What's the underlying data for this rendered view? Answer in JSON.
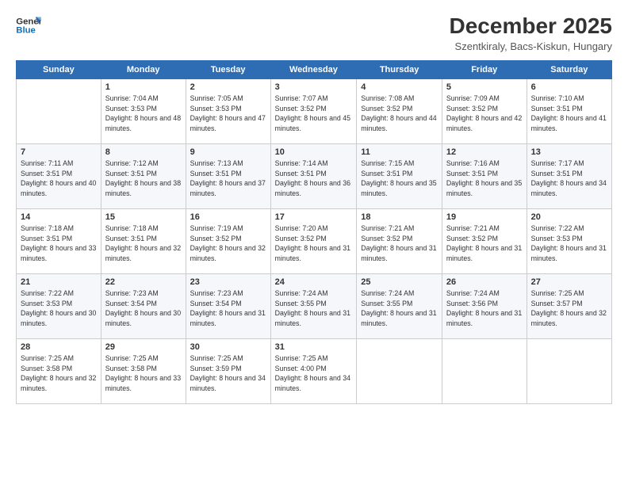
{
  "logo": {
    "line1": "General",
    "line2": "Blue"
  },
  "title": "December 2025",
  "subtitle": "Szentkiraly, Bacs-Kiskun, Hungary",
  "days_of_week": [
    "Sunday",
    "Monday",
    "Tuesday",
    "Wednesday",
    "Thursday",
    "Friday",
    "Saturday"
  ],
  "weeks": [
    [
      {
        "day": "",
        "info": ""
      },
      {
        "day": "1",
        "info": "Sunrise: 7:04 AM\nSunset: 3:53 PM\nDaylight: 8 hours\nand 48 minutes."
      },
      {
        "day": "2",
        "info": "Sunrise: 7:05 AM\nSunset: 3:53 PM\nDaylight: 8 hours\nand 47 minutes."
      },
      {
        "day": "3",
        "info": "Sunrise: 7:07 AM\nSunset: 3:52 PM\nDaylight: 8 hours\nand 45 minutes."
      },
      {
        "day": "4",
        "info": "Sunrise: 7:08 AM\nSunset: 3:52 PM\nDaylight: 8 hours\nand 44 minutes."
      },
      {
        "day": "5",
        "info": "Sunrise: 7:09 AM\nSunset: 3:52 PM\nDaylight: 8 hours\nand 42 minutes."
      },
      {
        "day": "6",
        "info": "Sunrise: 7:10 AM\nSunset: 3:51 PM\nDaylight: 8 hours\nand 41 minutes."
      }
    ],
    [
      {
        "day": "7",
        "info": "Sunrise: 7:11 AM\nSunset: 3:51 PM\nDaylight: 8 hours\nand 40 minutes."
      },
      {
        "day": "8",
        "info": "Sunrise: 7:12 AM\nSunset: 3:51 PM\nDaylight: 8 hours\nand 38 minutes."
      },
      {
        "day": "9",
        "info": "Sunrise: 7:13 AM\nSunset: 3:51 PM\nDaylight: 8 hours\nand 37 minutes."
      },
      {
        "day": "10",
        "info": "Sunrise: 7:14 AM\nSunset: 3:51 PM\nDaylight: 8 hours\nand 36 minutes."
      },
      {
        "day": "11",
        "info": "Sunrise: 7:15 AM\nSunset: 3:51 PM\nDaylight: 8 hours\nand 35 minutes."
      },
      {
        "day": "12",
        "info": "Sunrise: 7:16 AM\nSunset: 3:51 PM\nDaylight: 8 hours\nand 35 minutes."
      },
      {
        "day": "13",
        "info": "Sunrise: 7:17 AM\nSunset: 3:51 PM\nDaylight: 8 hours\nand 34 minutes."
      }
    ],
    [
      {
        "day": "14",
        "info": "Sunrise: 7:18 AM\nSunset: 3:51 PM\nDaylight: 8 hours\nand 33 minutes."
      },
      {
        "day": "15",
        "info": "Sunrise: 7:18 AM\nSunset: 3:51 PM\nDaylight: 8 hours\nand 32 minutes."
      },
      {
        "day": "16",
        "info": "Sunrise: 7:19 AM\nSunset: 3:52 PM\nDaylight: 8 hours\nand 32 minutes."
      },
      {
        "day": "17",
        "info": "Sunrise: 7:20 AM\nSunset: 3:52 PM\nDaylight: 8 hours\nand 31 minutes."
      },
      {
        "day": "18",
        "info": "Sunrise: 7:21 AM\nSunset: 3:52 PM\nDaylight: 8 hours\nand 31 minutes."
      },
      {
        "day": "19",
        "info": "Sunrise: 7:21 AM\nSunset: 3:52 PM\nDaylight: 8 hours\nand 31 minutes."
      },
      {
        "day": "20",
        "info": "Sunrise: 7:22 AM\nSunset: 3:53 PM\nDaylight: 8 hours\nand 31 minutes."
      }
    ],
    [
      {
        "day": "21",
        "info": "Sunrise: 7:22 AM\nSunset: 3:53 PM\nDaylight: 8 hours\nand 30 minutes."
      },
      {
        "day": "22",
        "info": "Sunrise: 7:23 AM\nSunset: 3:54 PM\nDaylight: 8 hours\nand 30 minutes."
      },
      {
        "day": "23",
        "info": "Sunrise: 7:23 AM\nSunset: 3:54 PM\nDaylight: 8 hours\nand 31 minutes."
      },
      {
        "day": "24",
        "info": "Sunrise: 7:24 AM\nSunset: 3:55 PM\nDaylight: 8 hours\nand 31 minutes."
      },
      {
        "day": "25",
        "info": "Sunrise: 7:24 AM\nSunset: 3:55 PM\nDaylight: 8 hours\nand 31 minutes."
      },
      {
        "day": "26",
        "info": "Sunrise: 7:24 AM\nSunset: 3:56 PM\nDaylight: 8 hours\nand 31 minutes."
      },
      {
        "day": "27",
        "info": "Sunrise: 7:25 AM\nSunset: 3:57 PM\nDaylight: 8 hours\nand 32 minutes."
      }
    ],
    [
      {
        "day": "28",
        "info": "Sunrise: 7:25 AM\nSunset: 3:58 PM\nDaylight: 8 hours\nand 32 minutes."
      },
      {
        "day": "29",
        "info": "Sunrise: 7:25 AM\nSunset: 3:58 PM\nDaylight: 8 hours\nand 33 minutes."
      },
      {
        "day": "30",
        "info": "Sunrise: 7:25 AM\nSunset: 3:59 PM\nDaylight: 8 hours\nand 34 minutes."
      },
      {
        "day": "31",
        "info": "Sunrise: 7:25 AM\nSunset: 4:00 PM\nDaylight: 8 hours\nand 34 minutes."
      },
      {
        "day": "",
        "info": ""
      },
      {
        "day": "",
        "info": ""
      },
      {
        "day": "",
        "info": ""
      }
    ]
  ]
}
